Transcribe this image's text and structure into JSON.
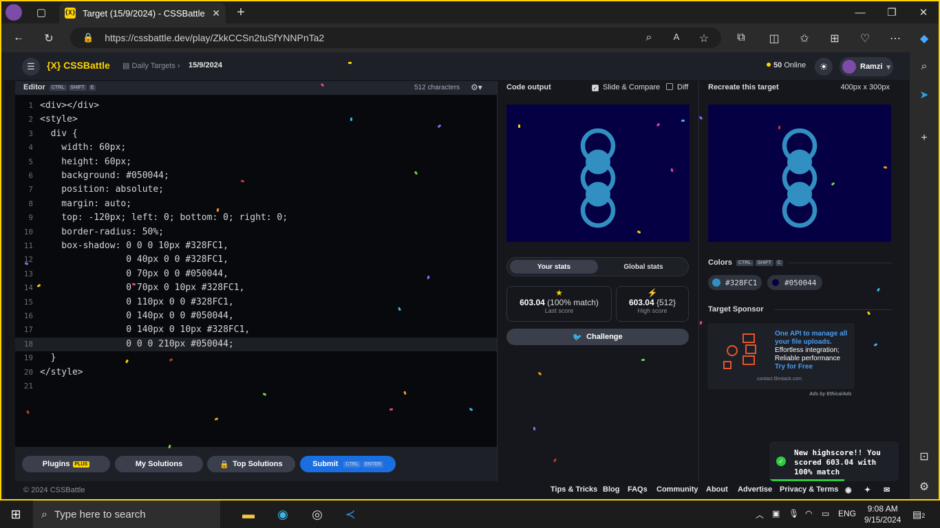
{
  "browser": {
    "tab_title": "Target (15/9/2024) - CSSBattle",
    "favicon_text": "{X}",
    "url": "https://cssbattle.dev/play/ZkkCCSn2tuSfYNNPnTa2"
  },
  "header": {
    "logo": "{X} CSSBattle",
    "breadcrumb_parent": "Daily Targets",
    "breadcrumb_current": "15/9/2024",
    "online_count": "50",
    "online_label": "Online",
    "username": "Ramzi"
  },
  "editor": {
    "label": "Editor",
    "shortcut": [
      "CTRL",
      "SHIFT",
      "E"
    ],
    "char_count": "512 characters",
    "lines": [
      {
        "n": "1",
        "text": "<div></div>"
      },
      {
        "n": "2",
        "text": "<style>"
      },
      {
        "n": "3",
        "text": "  div {"
      },
      {
        "n": "4",
        "text": "    width: 60px;"
      },
      {
        "n": "5",
        "text": "    height: 60px;"
      },
      {
        "n": "6",
        "text": "    background: #050044;"
      },
      {
        "n": "7",
        "text": "    position: absolute;"
      },
      {
        "n": "8",
        "text": "    margin: auto;"
      },
      {
        "n": "9",
        "text": "    top: -120px; left: 0; bottom: 0; right: 0;"
      },
      {
        "n": "10",
        "text": "    border-radius: 50%;"
      },
      {
        "n": "11",
        "text": "    box-shadow: 0 0 0 10px #328FC1,"
      },
      {
        "n": "12",
        "text": "                0 40px 0 0 #328FC1,"
      },
      {
        "n": "13",
        "text": "                0 70px 0 0 #050044,"
      },
      {
        "n": "14",
        "text": "                0 70px 0 10px #328FC1,"
      },
      {
        "n": "15",
        "text": "                0 110px 0 0 #328FC1,"
      },
      {
        "n": "16",
        "text": "                0 140px 0 0 #050044,"
      },
      {
        "n": "17",
        "text": "                0 140px 0 10px #328FC1,"
      },
      {
        "n": "18",
        "text": "                0 0 0 210px #050044;"
      },
      {
        "n": "19",
        "text": "  }"
      },
      {
        "n": "20",
        "text": "</style>"
      },
      {
        "n": "21",
        "text": ""
      }
    ],
    "active_line": 18
  },
  "editor_footer": {
    "plugins": "Plugins",
    "plugins_badge": "PLUS",
    "my_solutions": "My Solutions",
    "top_solutions": "Top Solutions",
    "submit": "Submit",
    "submit_keys": [
      "CTRL",
      "ENTER"
    ]
  },
  "output": {
    "title": "Code output",
    "slide_compare": "Slide & Compare",
    "slide_compare_checked": true,
    "diff": "Diff",
    "diff_checked": false,
    "tabs": [
      "Your stats",
      "Global stats"
    ],
    "last_score": "603.04",
    "last_match": "(100% match)",
    "last_label": "Last score",
    "high_score": "603.04",
    "high_chars": "{512}",
    "high_label": "High score",
    "challenge": "Challenge"
  },
  "target": {
    "title": "Recreate this target",
    "size": "400px x 300px",
    "colors_label": "Colors",
    "colors_keys": [
      "CTRL",
      "SHIFT",
      "C"
    ],
    "colors": [
      {
        "hex": "#328FC1"
      },
      {
        "hex": "#050044"
      }
    ],
    "sponsor_label": "Target Sponsor",
    "sponsor_headline": "One API to manage all your file uploads.",
    "sponsor_body": "Effortless integration; Reliable performance",
    "sponsor_link": "Try for Free",
    "sponsor_domain": "contact.filestack.com",
    "ads_by": "Ads by EthicalAds"
  },
  "toast": {
    "message": "New highscore!! You scored 603.04 with 100% match",
    "progress": 0.58
  },
  "footer": {
    "copyright": "© 2024 CSSBattle",
    "links": [
      "Tips & Tricks",
      "Blog",
      "FAQs",
      "Community",
      "About",
      "Advertise",
      "Privacy & Terms"
    ]
  },
  "taskbar": {
    "search_placeholder": "Type here to search",
    "lang": "ENG",
    "time": "9:08 AM",
    "date": "9/15/2024",
    "notifications": "2"
  },
  "palette": {
    "ring": "#328FC1",
    "bg": "#050044",
    "accent": "#ffd400",
    "submit": "#1b6ee0"
  }
}
